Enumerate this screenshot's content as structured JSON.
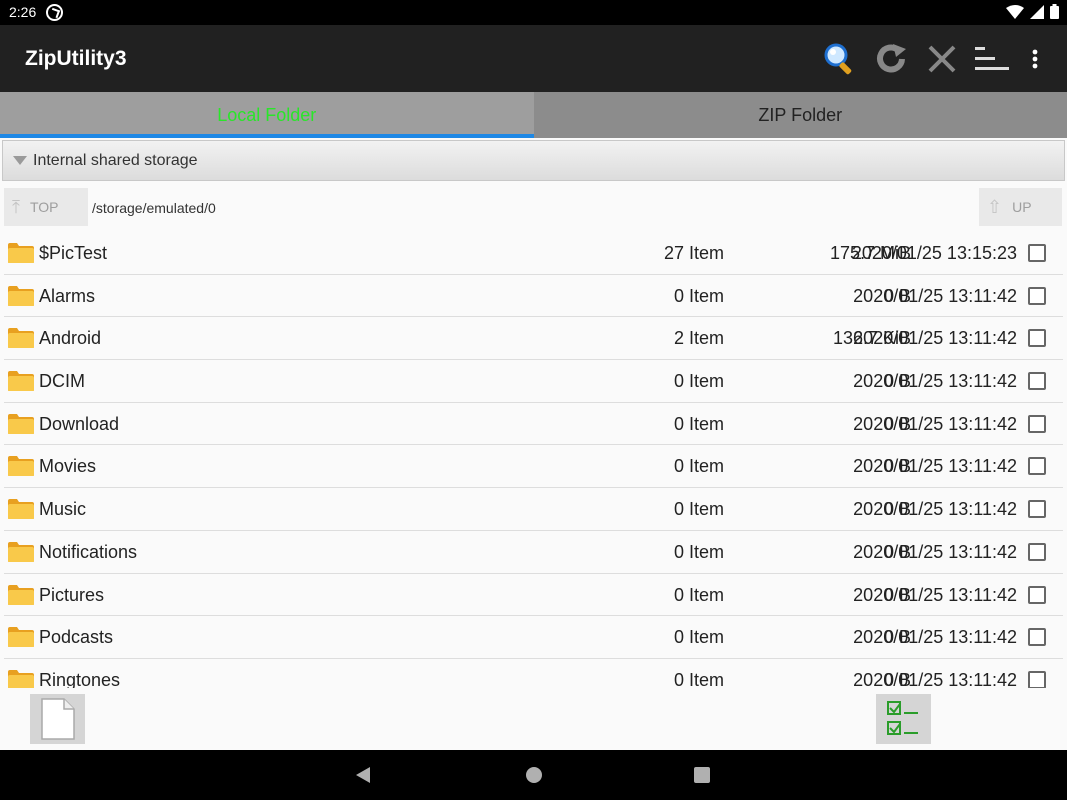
{
  "status_bar": {
    "time": "2:26"
  },
  "app": {
    "title": "ZipUtility3"
  },
  "toolbar": {
    "search_icon": "search-icon",
    "refresh_icon": "refresh-icon",
    "close_icon": "close-icon",
    "sort_icon": "sort-icon",
    "overflow_icon": "more-vert-icon"
  },
  "tabs": [
    {
      "label": "Local Folder",
      "active": true,
      "color": "#29e629"
    },
    {
      "label": "ZIP Folder",
      "active": false
    }
  ],
  "storage": {
    "label": "Internal shared storage"
  },
  "nav": {
    "top_label": "TOP",
    "up_label": "UP",
    "path": "/storage/emulated/0"
  },
  "files": [
    {
      "name": "$PicTest",
      "items": "27 Item",
      "size": "175.7 MiB",
      "date": "2020/01/25 13:15:23"
    },
    {
      "name": "Alarms",
      "items": "0 Item",
      "size": "0 B",
      "date": "2020/01/25 13:11:42"
    },
    {
      "name": "Android",
      "items": "2 Item",
      "size": "136.7 KiB",
      "date": "2020/01/25 13:11:42"
    },
    {
      "name": "DCIM",
      "items": "0 Item",
      "size": "0 B",
      "date": "2020/01/25 13:11:42"
    },
    {
      "name": "Download",
      "items": "0 Item",
      "size": "0 B",
      "date": "2020/01/25 13:11:42"
    },
    {
      "name": "Movies",
      "items": "0 Item",
      "size": "0 B",
      "date": "2020/01/25 13:11:42"
    },
    {
      "name": "Music",
      "items": "0 Item",
      "size": "0 B",
      "date": "2020/01/25 13:11:42"
    },
    {
      "name": "Notifications",
      "items": "0 Item",
      "size": "0 B",
      "date": "2020/01/25 13:11:42"
    },
    {
      "name": "Pictures",
      "items": "0 Item",
      "size": "0 B",
      "date": "2020/01/25 13:11:42"
    },
    {
      "name": "Podcasts",
      "items": "0 Item",
      "size": "0 B",
      "date": "2020/01/25 13:11:42"
    },
    {
      "name": "Ringtones",
      "items": "0 Item",
      "size": "0 B",
      "date": "2020/01/25 13:11:42"
    }
  ],
  "bottom": {
    "new_file_icon": "new-file-icon",
    "select_all_icon": "checklist-icon"
  }
}
